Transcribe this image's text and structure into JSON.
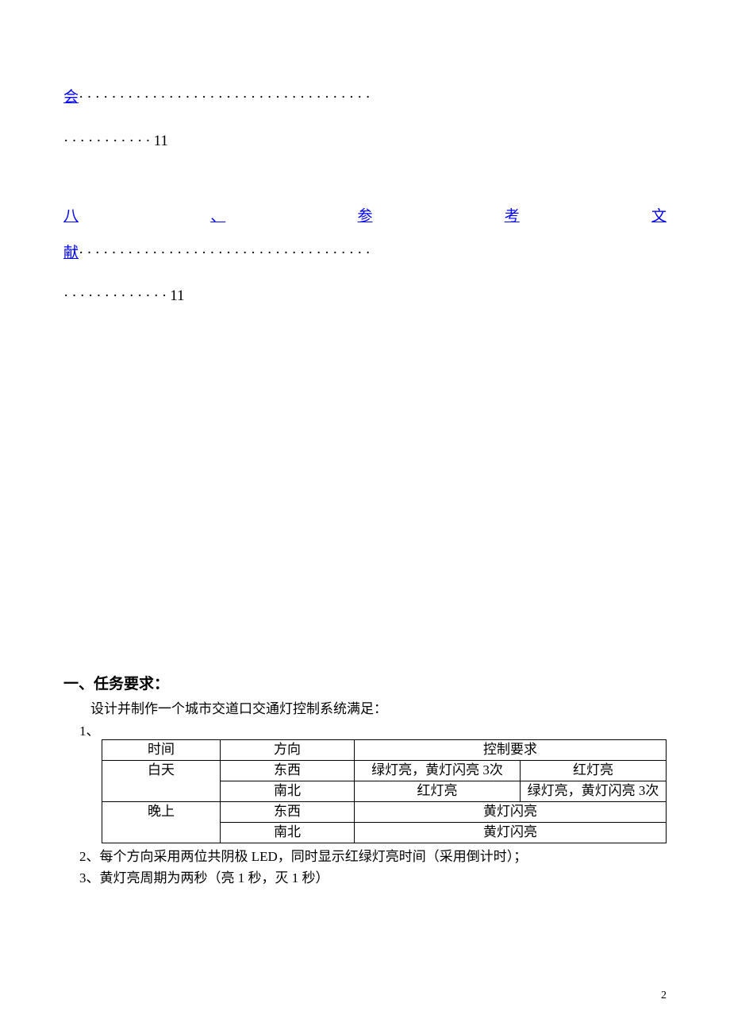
{
  "toc": {
    "item7": {
      "title_fragment": "会",
      "dots1": "····································",
      "dots2": "···········",
      "page": "11"
    },
    "item8": {
      "c1": "八",
      "c2": "、",
      "c3": "参",
      "c4": "考",
      "c5": "文",
      "title_fragment_line2": "献",
      "dots1": "····································",
      "dots2": "·············",
      "page": "11"
    }
  },
  "section1": {
    "heading": "一、任务要求：",
    "intro": "设计并制作一个城市交道口交通灯控制系统满足：",
    "list1_num": "1、"
  },
  "table": {
    "header": {
      "time": "时间",
      "direction": "方向",
      "control": "控制要求"
    },
    "day_label": "白天",
    "night_label": "晚上",
    "dir_ew": "东西",
    "dir_ns": "南北",
    "green_yellow3": "绿灯亮，黄灯闪亮 3次",
    "red": "红灯亮",
    "yellow_flash": "黄灯闪亮"
  },
  "notes": {
    "n2": "2、每个方向采用两位共阴极 LED，同时显示红绿灯亮时间（采用倒计时）；",
    "n3": "3、黄灯亮周期为两秒（亮 1 秒，灭 1 秒）"
  },
  "page_number": "2"
}
